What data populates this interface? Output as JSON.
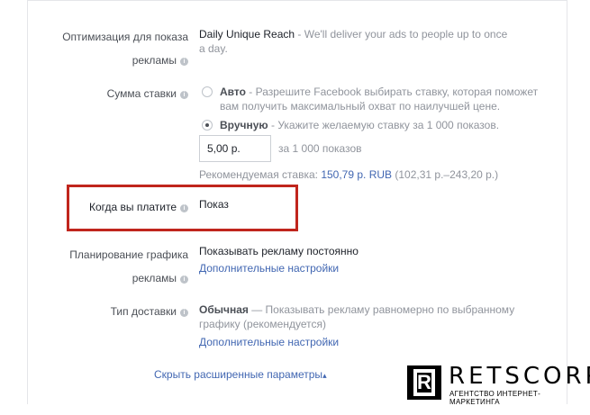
{
  "optimization": {
    "label_line1": "Оптимизация для показа",
    "label_line2": "рекламы",
    "value_title": "Daily Unique Reach",
    "value_desc": " - We'll deliver your ads to people up to once",
    "value_desc2": "a day."
  },
  "bid": {
    "label": "Сумма ставки",
    "auto_title": "Авто",
    "auto_desc": " - Разрешите Facebook выбирать ставку, которая поможет",
    "auto_desc2": "вам получить максимальный охват по наилучшей цене.",
    "manual_title": "Вручную",
    "manual_desc": " - Укажите желаемую ставку за 1 000 показов.",
    "input_value": "5,00 р.",
    "input_suffix": "за 1 000 показов",
    "recommended_label": "Рекомендуемая ставка: ",
    "recommended_value": "150,79 р. RUB",
    "recommended_range": " (102,31 р.–243,20 р.)",
    "selected": "manual"
  },
  "when_pay": {
    "label": "Когда вы платите",
    "value": "Показ"
  },
  "schedule": {
    "label_line1": "Планирование графика",
    "label_line2": "рекламы",
    "value": "Показывать рекламу постоянно",
    "link": "Дополнительные настройки"
  },
  "delivery": {
    "label": "Тип доставки",
    "value_title": "Обычная",
    "value_desc": " — Показывать рекламу равномерно по выбранному",
    "value_desc2": "графику (рекомендуется)",
    "link": "Дополнительные настройки"
  },
  "footer": {
    "hide_link": "Скрыть расширенные параметры",
    "caret": "▴"
  },
  "watermark": {
    "logo_letter": "R",
    "brand": "RETSCORP",
    "tagline": "АГЕНТСТВО ИНТЕРНЕТ-МАРКЕТИНГА"
  },
  "colors": {
    "highlight": "#c0251d",
    "link": "#4267b2"
  }
}
